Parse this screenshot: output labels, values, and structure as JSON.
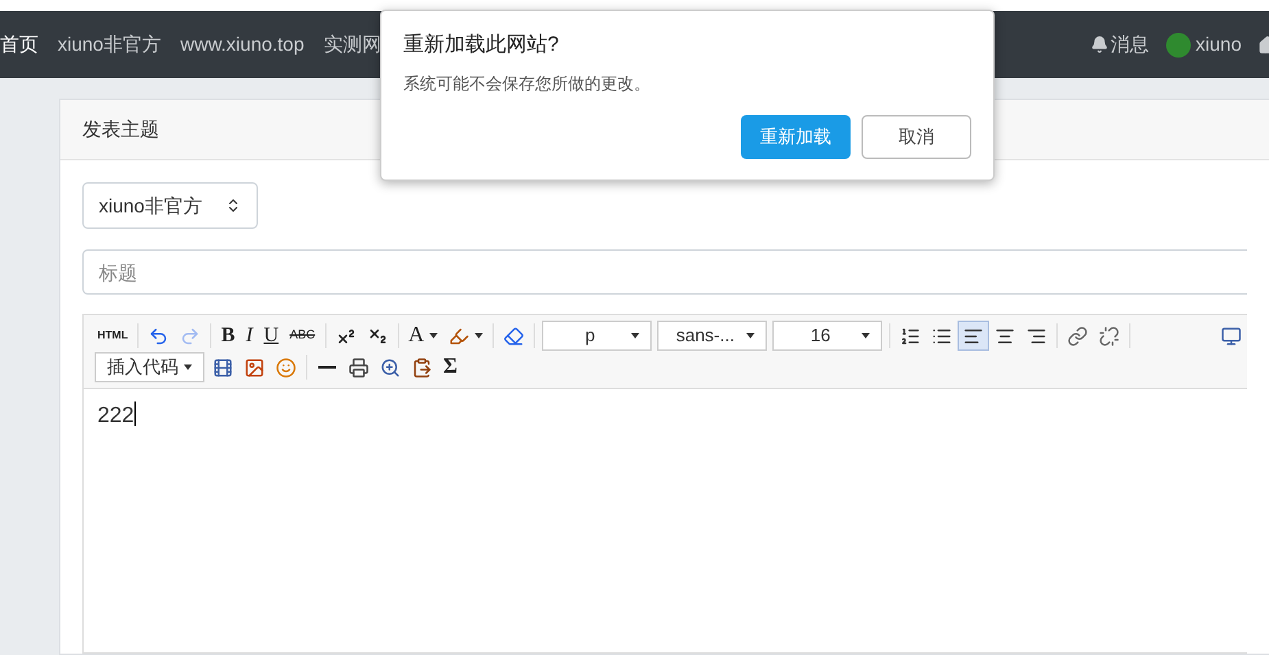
{
  "navbar": {
    "links": [
      "首页",
      "xiuno非官方",
      "www.xiuno.top",
      "实测网"
    ],
    "messages": "消息",
    "user": "xiuno"
  },
  "dialog": {
    "title": "重新加载此网站?",
    "message": "系统可能不会保存您所做的更改。",
    "buttons": [
      {
        "label": "重新加载",
        "kind": "primary"
      },
      {
        "label": "取消",
        "kind": "secondary"
      }
    ]
  },
  "card": {
    "title": "发表主题",
    "forum_select": "xiuno非官方",
    "title_field": {
      "placeholder": "标题"
    }
  },
  "toolbar": {
    "rows": [
      [
        {
          "kind": "text",
          "label": "HTML"
        },
        {
          "kind": "sep"
        },
        {
          "kind": "icon",
          "disabled": false
        },
        {
          "kind": "icon",
          "disabled": true
        },
        {
          "kind": "sep"
        },
        {
          "kind": "text",
          "label": "B"
        },
        {
          "kind": "text",
          "label": "I"
        },
        {
          "kind": "text",
          "label": "U"
        },
        {
          "kind": "text",
          "label": "ABC"
        },
        {
          "kind": "sep"
        },
        {
          "kind": "icon",
          "disabled": false
        },
        {
          "kind": "icon",
          "disabled": false
        },
        {
          "kind": "sep"
        },
        {
          "kind": "text",
          "label": "A"
        },
        {
          "kind": "icon",
          "disabled": false
        },
        {
          "kind": "sep"
        },
        {
          "kind": "icon",
          "disabled": false
        },
        {
          "kind": "sep"
        },
        {
          "kind": "select",
          "value": "p"
        },
        {
          "kind": "select",
          "value": "sans-..."
        },
        {
          "kind": "select",
          "value": "16"
        },
        {
          "kind": "sep"
        },
        {
          "kind": "icon",
          "disabled": false
        },
        {
          "kind": "icon",
          "disabled": false
        },
        {
          "kind": "icon",
          "disabled": false,
          "selected": true
        },
        {
          "kind": "icon",
          "disabled": false,
          "selected": false
        },
        {
          "kind": "icon",
          "disabled": false,
          "selected": false
        },
        {
          "kind": "sep"
        },
        {
          "kind": "icon",
          "disabled": false
        },
        {
          "kind": "icon",
          "disabled": false
        },
        {
          "kind": "sep"
        },
        {
          "kind": "spacer"
        },
        {
          "kind": "icon",
          "disabled": false
        }
      ],
      [
        {
          "kind": "select",
          "value": "插入代码"
        },
        {
          "kind": "icon",
          "disabled": false
        },
        {
          "kind": "icon",
          "disabled": false
        },
        {
          "kind": "icon",
          "disabled": false
        },
        {
          "kind": "sep"
        },
        {
          "kind": "icon",
          "disabled": false
        },
        {
          "kind": "icon",
          "disabled": false
        },
        {
          "kind": "icon",
          "disabled": false
        },
        {
          "kind": "icon",
          "disabled": false
        },
        {
          "kind": "text",
          "label": "Σ"
        }
      ]
    ]
  },
  "editor": {
    "content": "222"
  }
}
